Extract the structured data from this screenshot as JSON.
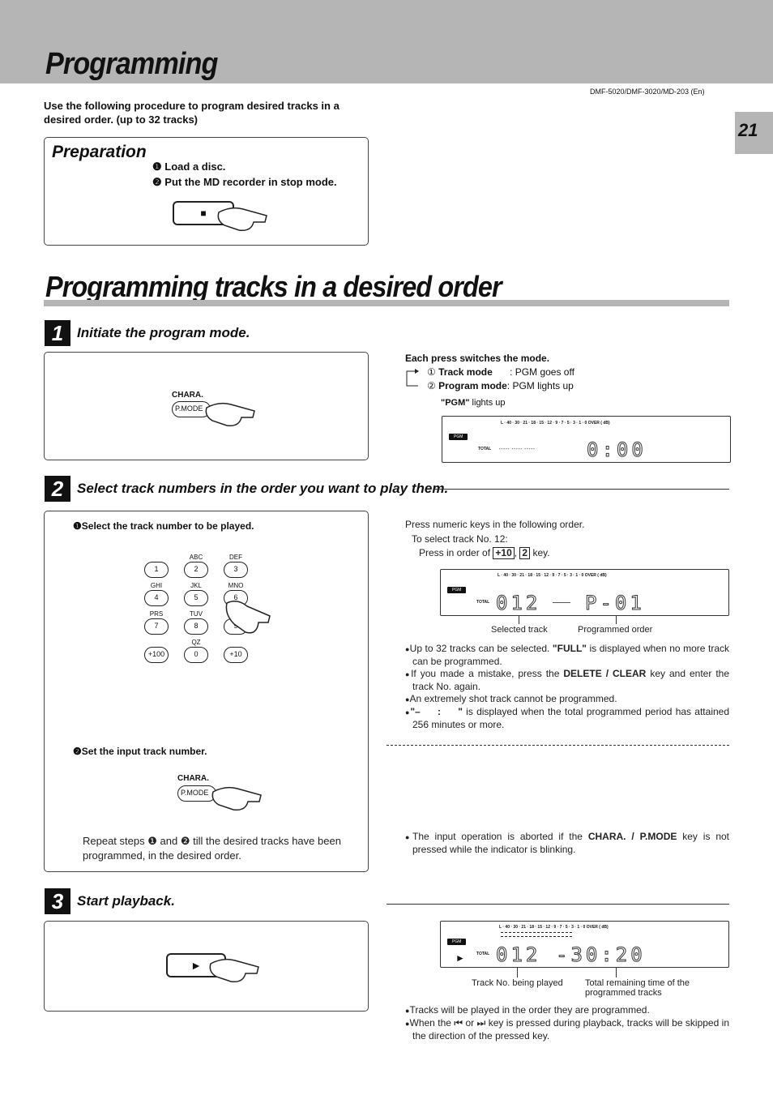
{
  "header": {
    "title": "Programming",
    "model": "DMF-5020/DMF-3020/MD-203 (En)",
    "page_number": "21"
  },
  "intro": "Use the following procedure to program desired tracks in a desired order. (up to 32 tracks)",
  "preparation": {
    "title": "Preparation",
    "steps": [
      "Load a disc.",
      "Put the MD recorder in stop mode."
    ],
    "stop_symbol": "■"
  },
  "section_title": "Programming tracks in a desired order",
  "step1": {
    "num": "1",
    "title": "Initiate the program mode.",
    "key_label": "CHARA.",
    "key_text": "P.MODE",
    "mode_heading": "Each press switches the mode.",
    "modes": [
      {
        "num": "①",
        "name": "Track mode",
        "desc": ": PGM goes off"
      },
      {
        "num": "②",
        "name": "Program mode",
        "desc": ": PGM lights up"
      }
    ],
    "pgm_note_bold": "\"PGM\"",
    "pgm_note": " lights up",
    "display": {
      "meter": "L  · 40 · 30 · 21 · 18 · 15 · 12 · 9 · 7 · 5 · 3 · 1 · 0  OVER ( dB)",
      "pgm": "PGM",
      "total": "TOTAL",
      "dashes": "----- ----- -----",
      "time": "0:00"
    }
  },
  "step2": {
    "num": "2",
    "title": "Select track numbers in the order you want to play them.",
    "sub1": "Select the track number to be played.",
    "sub2": "Set the input track number.",
    "keypad": {
      "keys": [
        "1",
        "2",
        "3",
        "4",
        "5",
        "6",
        "7",
        "8",
        "9",
        "+100",
        "0",
        "+10"
      ],
      "letters": [
        "",
        "ABC",
        "DEF",
        "GHI",
        "JKL",
        "MNO",
        "PRS",
        "TUV",
        "",
        "",
        "QZ",
        ""
      ]
    },
    "key_label": "CHARA.",
    "key_text": "P.MODE",
    "repeat_a": "Repeat steps",
    "repeat_and": "and",
    "repeat_b": "till the desired tracks have been programmed, in the desired order.",
    "instr1": "Press numeric keys in the following order.",
    "instr2": "To select track No. 12:",
    "instr3": "Press in order of",
    "key1": "+10",
    "key2": "2",
    "instr4": "key.",
    "display": {
      "pgm": "PGM",
      "total": "TOTAL",
      "track": "012",
      "order": "P-01",
      "meter": "L  · 40 · 30 · 21 · 18 · 15 · 12 · 9 · 7 · 5 · 3 · 1 · 0  OVER ( dB)"
    },
    "cap_selected": "Selected track",
    "cap_order": "Programmed order",
    "notes": [
      {
        "pre": "Up to 32 tracks can be selected. ",
        "bold": "\"FULL\"",
        "post": " is displayed when no more track can be programmed."
      },
      {
        "pre": "If you made a mistake, press the ",
        "bold": "DELETE / CLEAR",
        "post": " key and enter the track No. again."
      },
      {
        "pre": "An extremely shot track cannot be programmed.",
        "bold": "",
        "post": ""
      },
      {
        "pre": "",
        "bold": "\"–     :     \"",
        "post": " is displayed when the total programmed period has attained 256 minutes or more."
      }
    ],
    "abort_pre": "The input operation is aborted if the ",
    "abort_bold": "CHARA. / P.MODE",
    "abort_post": " key is not pressed while the indicator is blinking."
  },
  "step3": {
    "num": "3",
    "title": "Start playback.",
    "play_symbol": "►",
    "display": {
      "pgm": "PGM",
      "total": "TOTAL",
      "track": "012",
      "time": "-30:20",
      "meter": "L  · 40 · 30 · 21 · 18 · 15 · 12 · 9 · 7 · 5 · 3 · 1 · 0  OVER ( dB)"
    },
    "cap_track": "Track No. being played",
    "cap_time": "Total remaining time of the programmed tracks",
    "notes": [
      "Tracks will be played in the order they are programmed.",
      "When the ⏮ or ⏭ key is pressed during playback, tracks will be skipped in the direction of the pressed key."
    ]
  }
}
